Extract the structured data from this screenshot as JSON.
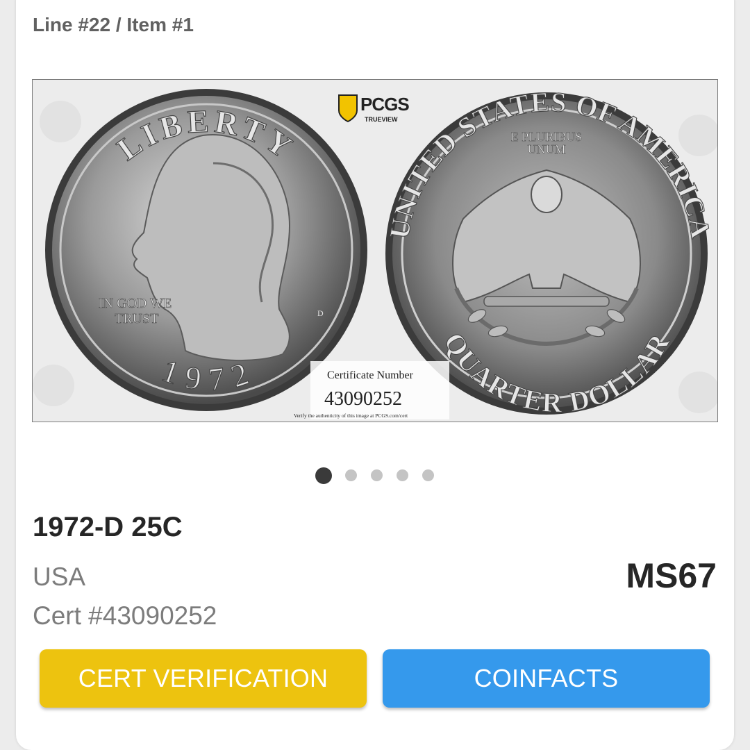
{
  "header": {
    "line_label": "Line #22 / Item #1"
  },
  "image": {
    "logo_text": "PCGS",
    "logo_sub": "TRUEVIEW",
    "obverse_top": "LIBERTY",
    "obverse_motto_1": "IN GOD WE",
    "obverse_motto_2": "TRUST",
    "obverse_year": "1972",
    "obverse_mint": "D",
    "reverse_top": "UNITED STATES OF AMERICA",
    "reverse_motto_1": "E PLURIBUS",
    "reverse_motto_2": "UNUM",
    "reverse_bottom": "QUARTER DOLLAR",
    "cert_caption": "Certificate Number",
    "cert_number": "43090252",
    "verify_text": "Verify the authenticity of this image at PCGS.com/cert"
  },
  "carousel": {
    "count": 5,
    "active_index": 0
  },
  "item": {
    "title": "1972-D 25C",
    "country": "USA",
    "cert": "Cert #43090252",
    "grade": "MS67"
  },
  "buttons": {
    "cert_verification": "CERT VERIFICATION",
    "coinfacts": "COINFACTS"
  },
  "colors": {
    "cert_button": "#edc30f",
    "coinfacts_button": "#3599ec",
    "logo_shield": "#f2c300"
  }
}
